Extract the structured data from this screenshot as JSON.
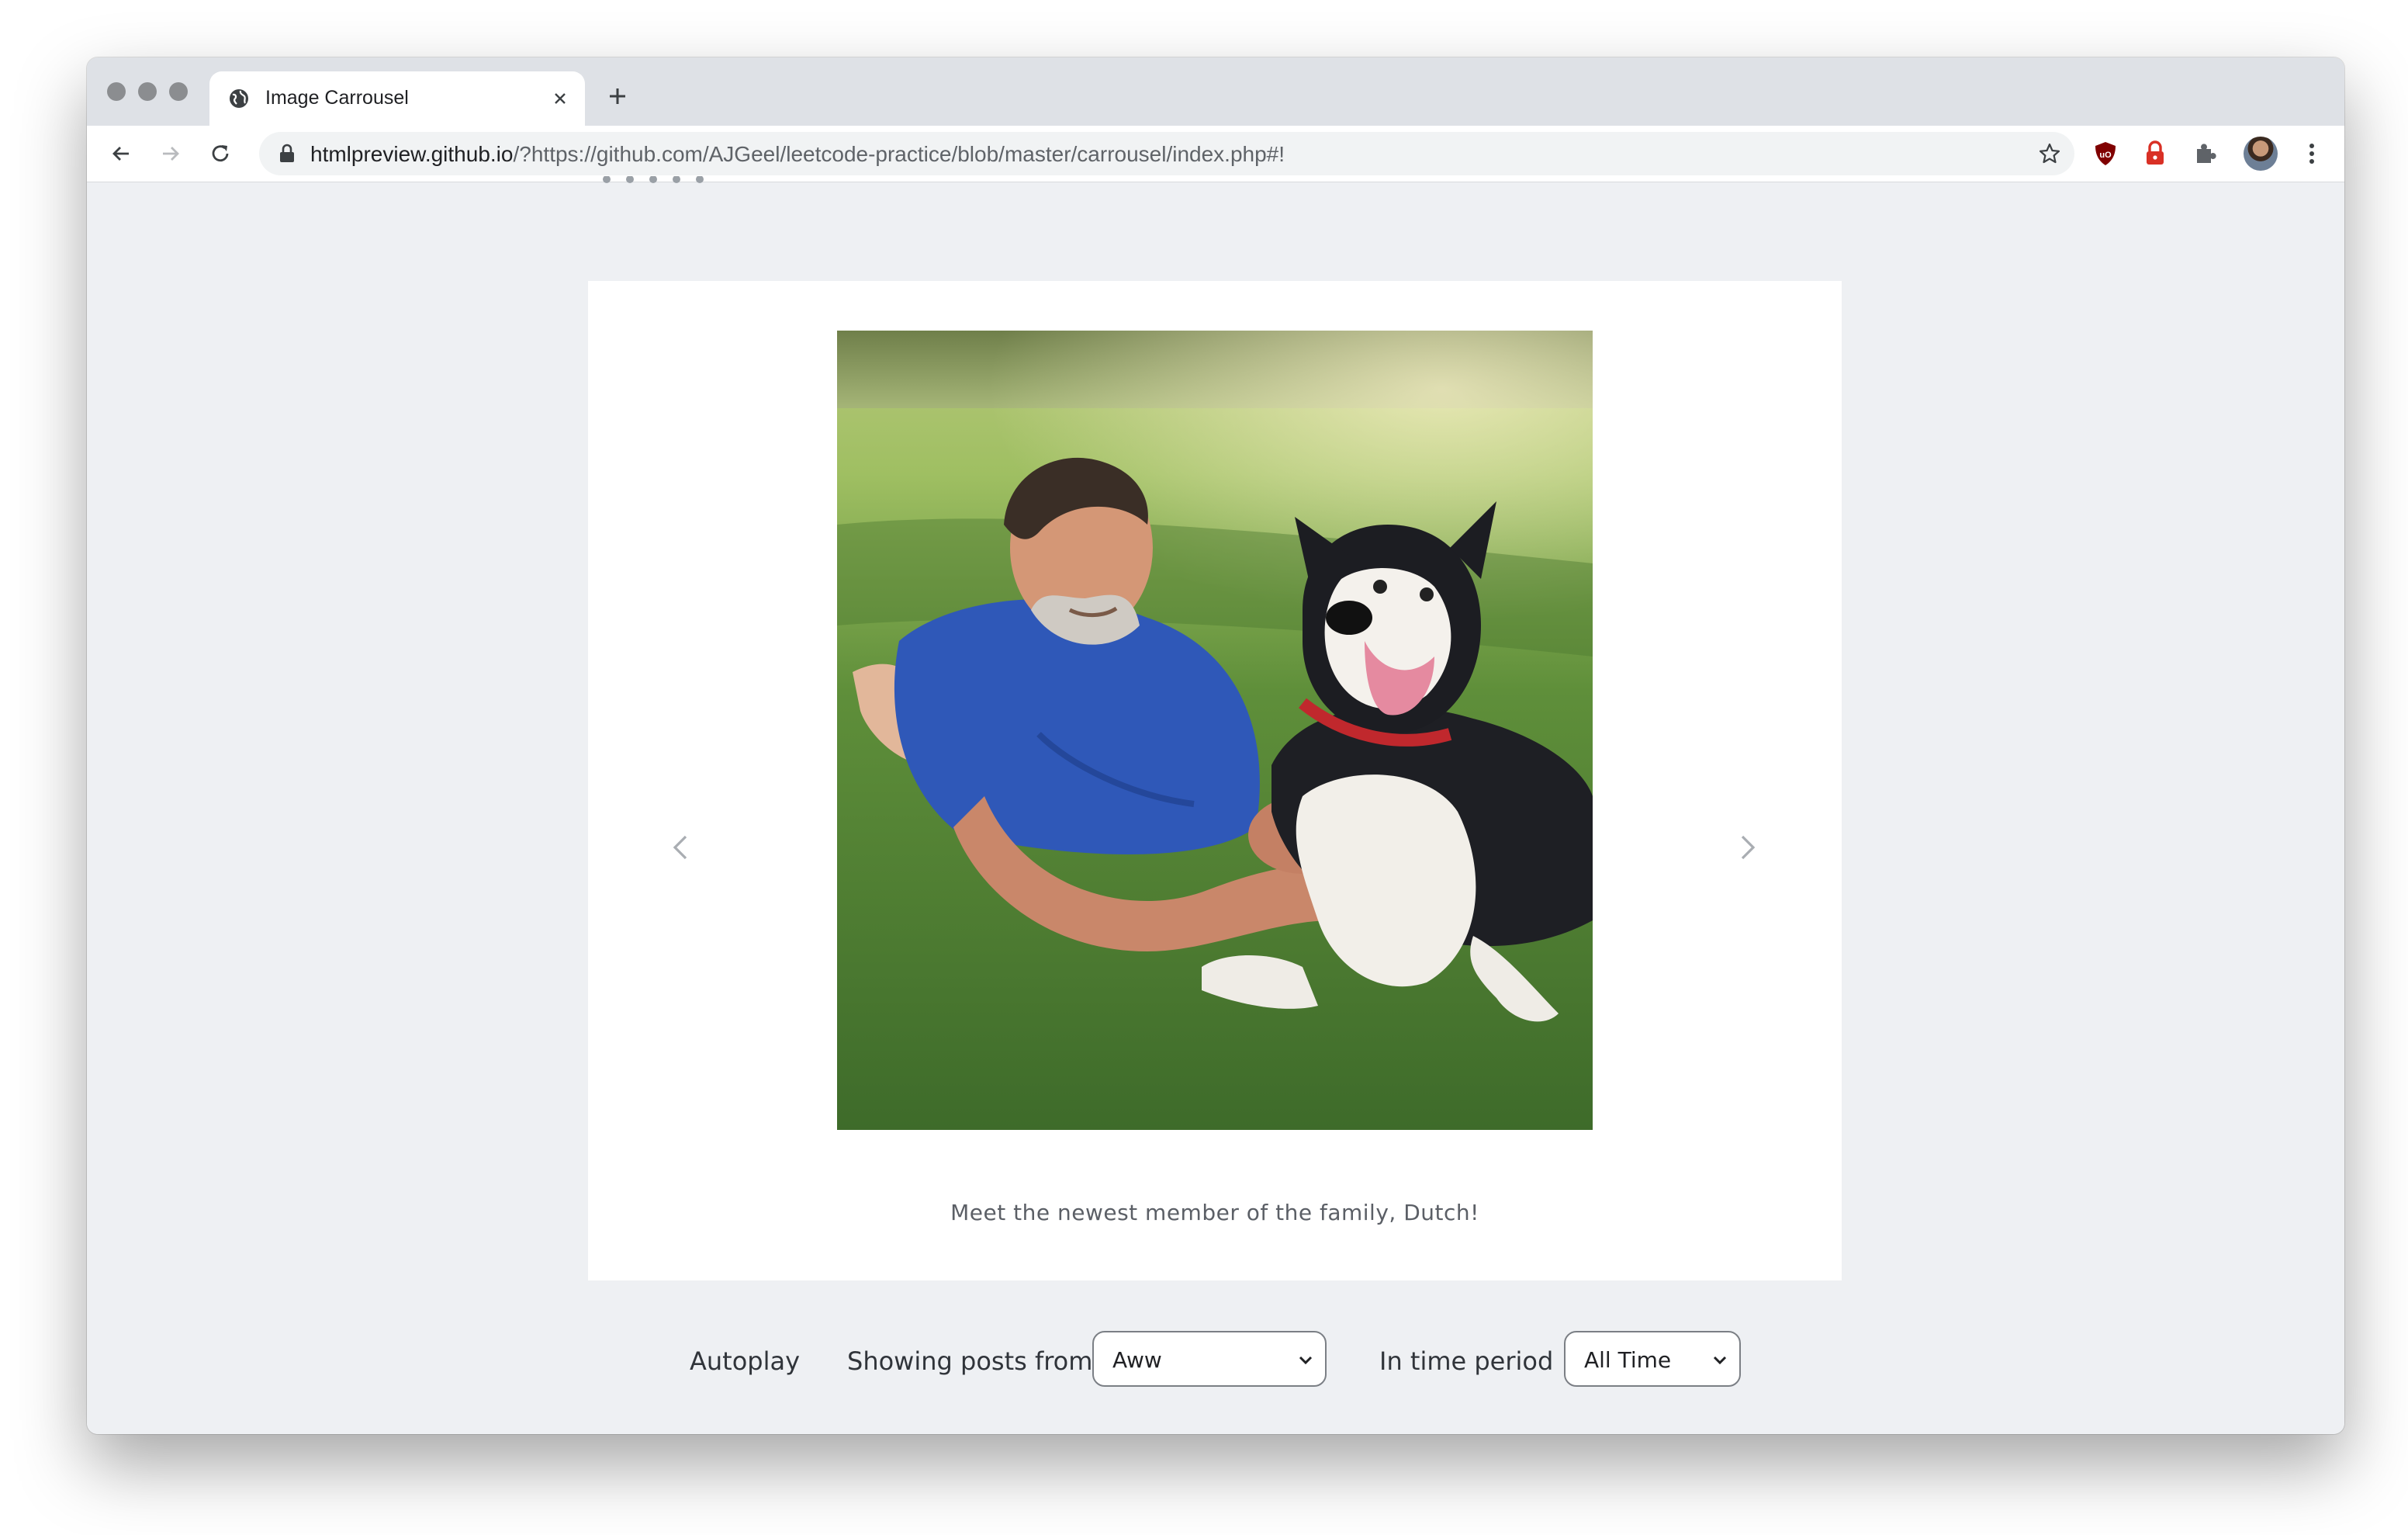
{
  "browser": {
    "tab_title": "Image Carrousel",
    "url_host": "htmlpreview.github.io",
    "url_path": "/?https://github.com/AJGeel/leetcode-practice/blob/master/carrousel/index.php#!"
  },
  "carousel": {
    "image_alt": "Man lying on grass with a black and white husky puppy",
    "caption": "Meet the newest member of the family, Dutch!",
    "prev_icon": "chevron-left-icon",
    "next_icon": "chevron-right-icon"
  },
  "controls": {
    "autoplay_label": "Autoplay",
    "source_label": "Showing posts from",
    "source_value": "Aww",
    "period_label": "In time period",
    "period_value": "All Time"
  },
  "colors": {
    "page_background": "#eef0f3",
    "card_background": "#ffffff",
    "tabstrip": "#dee1e6"
  }
}
